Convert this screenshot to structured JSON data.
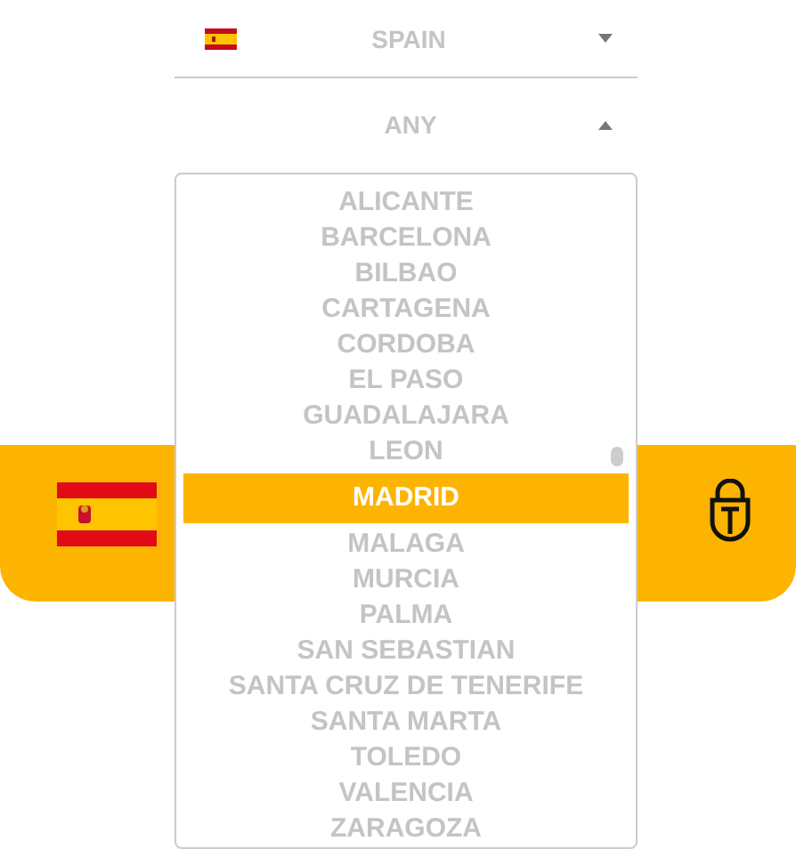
{
  "country_select": {
    "value": "SPAIN",
    "expanded": false
  },
  "city_select": {
    "value": "ANY",
    "expanded": true
  },
  "city_options": [
    {
      "label": "ALICANTE",
      "selected": false
    },
    {
      "label": "BARCELONA",
      "selected": false
    },
    {
      "label": "BILBAO",
      "selected": false
    },
    {
      "label": "CARTAGENA",
      "selected": false
    },
    {
      "label": "CORDOBA",
      "selected": false
    },
    {
      "label": "EL PASO",
      "selected": false
    },
    {
      "label": "GUADALAJARA",
      "selected": false
    },
    {
      "label": "LEON",
      "selected": false
    },
    {
      "label": "MADRID",
      "selected": true
    },
    {
      "label": "MALAGA",
      "selected": false
    },
    {
      "label": "MURCIA",
      "selected": false
    },
    {
      "label": "PALMA",
      "selected": false
    },
    {
      "label": "SAN SEBASTIAN",
      "selected": false
    },
    {
      "label": "SANTA CRUZ DE TENERIFE",
      "selected": false
    },
    {
      "label": "SANTA MARTA",
      "selected": false
    },
    {
      "label": "TOLEDO",
      "selected": false
    },
    {
      "label": "VALENCIA",
      "selected": false
    },
    {
      "label": "ZARAGOZA",
      "selected": false
    }
  ]
}
